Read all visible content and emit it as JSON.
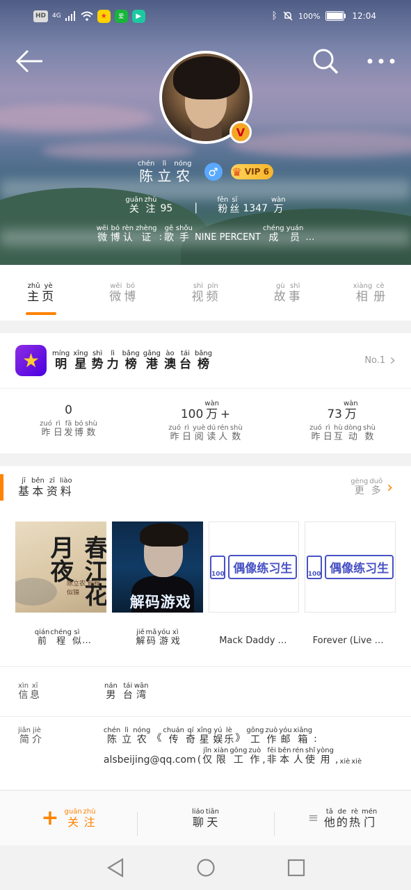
{
  "status_bar": {
    "network_hd": "HD",
    "network_type": "4G",
    "battery": "100%",
    "time": "12:04"
  },
  "profile": {
    "name": {
      "chars": [
        "陈",
        "立",
        "农"
      ],
      "pinyin": [
        "chén",
        "lì",
        "nóng"
      ]
    },
    "verified_badge": "V",
    "gender_icon": "♂",
    "vip_label": "VIP 6",
    "following": {
      "label": [
        "关",
        "注"
      ],
      "pinyin": [
        "guān",
        "zhù"
      ],
      "value": "95"
    },
    "separator": "|",
    "followers": {
      "label": [
        "粉",
        "丝"
      ],
      "pinyin": [
        "fěn",
        "sī"
      ],
      "value": "1347",
      "unit": "万",
      "unit_pinyin": "wàn"
    },
    "verification": {
      "label": [
        "微",
        "博",
        "认",
        "证"
      ],
      "label_pinyin": [
        "wēi",
        "bó",
        "rèn",
        "zhèng"
      ],
      "colon": ":",
      "role": [
        "歌",
        "手"
      ],
      "role_pinyin": [
        "gē",
        "shǒu"
      ],
      "group": "NINE PERCENT",
      "member": [
        "成",
        "员"
      ],
      "member_pinyin": [
        "chéng",
        "yuán"
      ],
      "ellipsis": "…"
    }
  },
  "tabs": [
    {
      "chars": [
        "主",
        "页"
      ],
      "pinyin": [
        "zhǔ",
        "yè"
      ],
      "active": true
    },
    {
      "chars": [
        "微",
        "博"
      ],
      "pinyin": [
        "wēi",
        "bó"
      ],
      "active": false
    },
    {
      "chars": [
        "视",
        "频"
      ],
      "pinyin": [
        "shì",
        "pín"
      ],
      "active": false
    },
    {
      "chars": [
        "故",
        "事"
      ],
      "pinyin": [
        "gù",
        "shì"
      ],
      "active": false
    },
    {
      "chars": [
        "相",
        "册"
      ],
      "pinyin": [
        "xiàng",
        "cè"
      ],
      "active": false
    }
  ],
  "rank": {
    "title_chars": [
      "明",
      "星",
      "势",
      "力",
      "榜",
      "港",
      "澳",
      "台",
      "榜"
    ],
    "title_pinyin": [
      "míng",
      "xīng",
      "shì",
      "lì",
      "bǎng",
      "gǎng",
      "ào",
      "tái",
      "bǎng"
    ],
    "position": "No.1",
    "logo_icon": "★"
  },
  "metrics": [
    {
      "value": "0",
      "unit": "",
      "unit_pinyin": "",
      "suffix": "",
      "label": [
        "昨",
        "日",
        "发",
        "博",
        "数"
      ],
      "label_pinyin": [
        "zuó",
        "rì",
        "fā",
        "bó",
        "shù"
      ]
    },
    {
      "value": "100",
      "unit": "万",
      "unit_pinyin": "wàn",
      "suffix": "+",
      "label": [
        "昨",
        "日",
        "阅",
        "读",
        "人",
        "数"
      ],
      "label_pinyin": [
        "zuó",
        "rì",
        "yuè",
        "dú",
        "rén",
        "shù"
      ]
    },
    {
      "value": "73",
      "unit": "万",
      "unit_pinyin": "wàn",
      "suffix": "",
      "label": [
        "昨",
        "日",
        "互",
        "动",
        "数"
      ],
      "label_pinyin": [
        "zuó",
        "rì",
        "hù",
        "dòng",
        "shù"
      ]
    }
  ],
  "basic_info": {
    "title": [
      "基",
      "本",
      "资",
      "料"
    ],
    "title_pinyin": [
      "jī",
      "běn",
      "zī",
      "liào"
    ],
    "more": [
      "更",
      "多"
    ],
    "more_pinyin": [
      "gèng",
      "duō"
    ],
    "albums": [
      {
        "cover_text": "春江花月夜",
        "cover_sub": "陈立农 前程似锦"
      },
      {
        "cover_text": "解码游戏"
      },
      {
        "cover_text": "偶像练习生",
        "cover_box": "100"
      },
      {
        "cover_text": "偶像练习生",
        "cover_box": "100"
      }
    ],
    "captions": [
      {
        "chars": [
          "前",
          "程",
          "似"
        ],
        "pinyin": [
          "qián",
          "chéng",
          "sì"
        ],
        "tail": "…"
      },
      {
        "chars": [
          "解",
          "码",
          "游",
          "戏"
        ],
        "pinyin": [
          "jiě",
          "mǎ",
          "yóu",
          "xì"
        ],
        "tail": ""
      },
      {
        "text": "Mack Daddy …"
      },
      {
        "text": "Forever (Live …"
      }
    ],
    "location": {
      "key": [
        "信",
        "息"
      ],
      "key_pinyin": [
        "xìn",
        "xī"
      ],
      "value": [
        "男",
        "台",
        "湾"
      ],
      "value_pinyin": [
        "nán",
        "tái",
        "wān"
      ]
    },
    "intro": {
      "key": [
        "简",
        "介"
      ],
      "key_pinyin": [
        "jiǎn",
        "jiè"
      ],
      "part1_chars": [
        "陈",
        "立",
        "农"
      ],
      "part1_pinyin": [
        "chén",
        "lì",
        "nóng"
      ],
      "open_quote": "《",
      "part2_chars": [
        "传",
        "奇",
        "星",
        "娱",
        "乐"
      ],
      "part2_pinyin": [
        "chuán",
        "qí",
        "xīng",
        "yú",
        "lè"
      ],
      "close_quote": "》",
      "part3_chars": [
        "工",
        "作",
        "邮",
        "箱"
      ],
      "part3_pinyin": [
        "gōng",
        "zuò",
        "yóu",
        "xiāng"
      ],
      "colon": ":",
      "email": "alsbeijing@qq.com",
      "open_paren": "(",
      "part4_chars": [
        "仅",
        "限",
        "工",
        "作"
      ],
      "part4_pinyin": [
        "jǐn",
        "xiàn",
        "gōng",
        "zuò"
      ],
      "comma1": ",",
      "part5_chars": [
        "非",
        "本",
        "人",
        "使",
        "用"
      ],
      "part5_pinyin": [
        "fēi",
        "běn",
        "rén",
        "shǐ",
        "yòng"
      ],
      "comma2": ",",
      "part6_pinyin": [
        "xiè",
        "xiè"
      ]
    }
  },
  "actions": [
    {
      "icon": "+",
      "chars": [
        "关",
        "注"
      ],
      "pinyin": [
        "guān",
        "zhù"
      ]
    },
    {
      "icon": "",
      "chars": [
        "聊",
        "天"
      ],
      "pinyin": [
        "liáo",
        "tiān"
      ]
    },
    {
      "icon": "≡",
      "chars": [
        "他",
        "的",
        "热",
        "门"
      ],
      "pinyin": [
        "tā",
        "de",
        "rè",
        "mén"
      ]
    }
  ],
  "colors": {
    "accent": "#ff8200",
    "vip_gold": "#f7b52c",
    "gender_blue": "#5aa9ff",
    "rank_purple": "#6a11cb"
  }
}
